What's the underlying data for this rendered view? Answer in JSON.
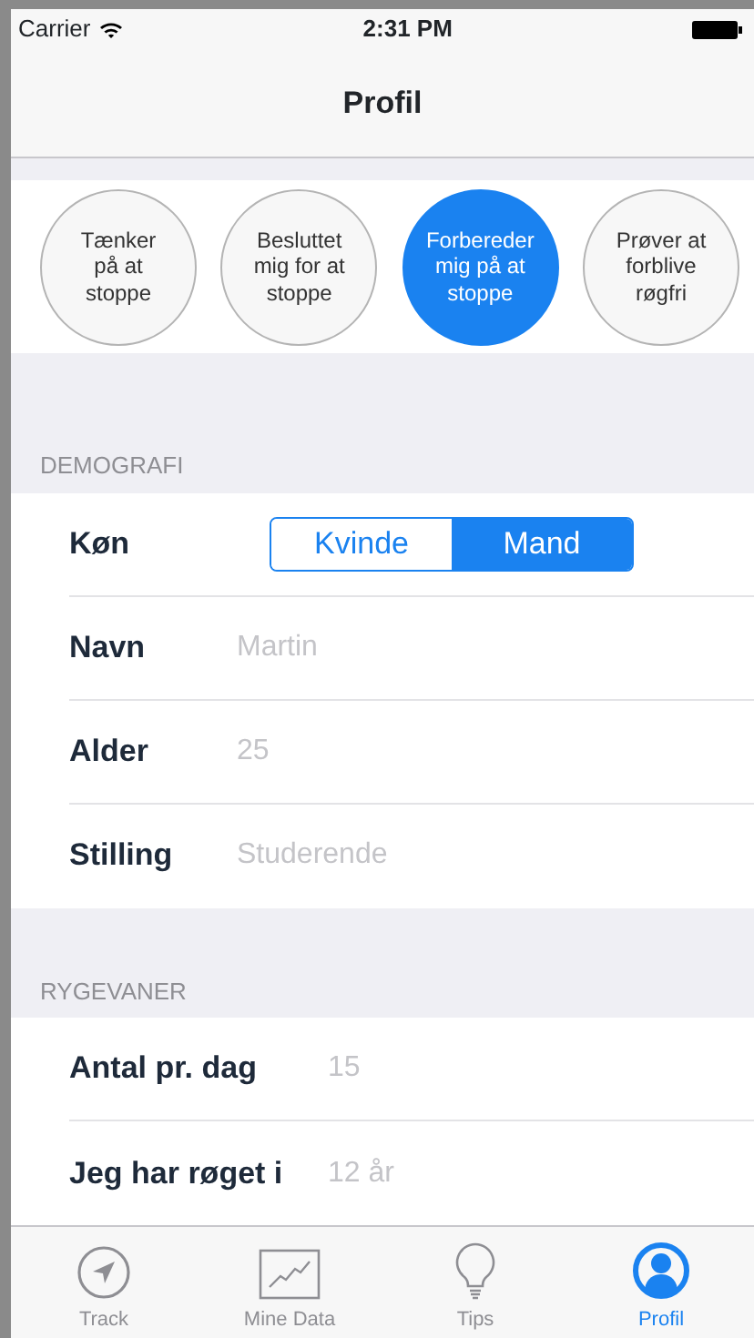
{
  "status_bar": {
    "carrier": "Carrier",
    "time": "2:31 PM"
  },
  "nav_bar": {
    "title": "Profil"
  },
  "stages": [
    {
      "label": "Tænker på at stoppe",
      "selected": false
    },
    {
      "label": "Besluttet mig for at stoppe",
      "selected": false
    },
    {
      "label": "Forbereder mig på at stoppe",
      "selected": true
    },
    {
      "label": "Prøver at forblive røgfri",
      "selected": false
    }
  ],
  "sections": [
    {
      "header": "DEMOGRAFI",
      "rows": [
        {
          "kind": "segmented",
          "label": "Køn",
          "options": [
            {
              "label": "Kvinde",
              "selected": false
            },
            {
              "label": "Mand",
              "selected": true
            }
          ]
        },
        {
          "kind": "field",
          "label": "Navn",
          "placeholder": "Martin"
        },
        {
          "kind": "field",
          "label": "Alder",
          "placeholder": "25"
        },
        {
          "kind": "field",
          "label": "Stilling",
          "placeholder": "Studerende"
        }
      ]
    },
    {
      "header": "RYGEVANER",
      "rows": [
        {
          "kind": "field",
          "label": "Antal pr. dag",
          "placeholder": "15"
        },
        {
          "kind": "field",
          "label": "Jeg har røget i",
          "placeholder": "12 år"
        }
      ]
    }
  ],
  "tab_bar": [
    {
      "label": "Track",
      "selected": false
    },
    {
      "label": "Mine Data",
      "selected": false
    },
    {
      "label": "Tips",
      "selected": false
    },
    {
      "label": "Profil",
      "selected": true
    }
  ]
}
